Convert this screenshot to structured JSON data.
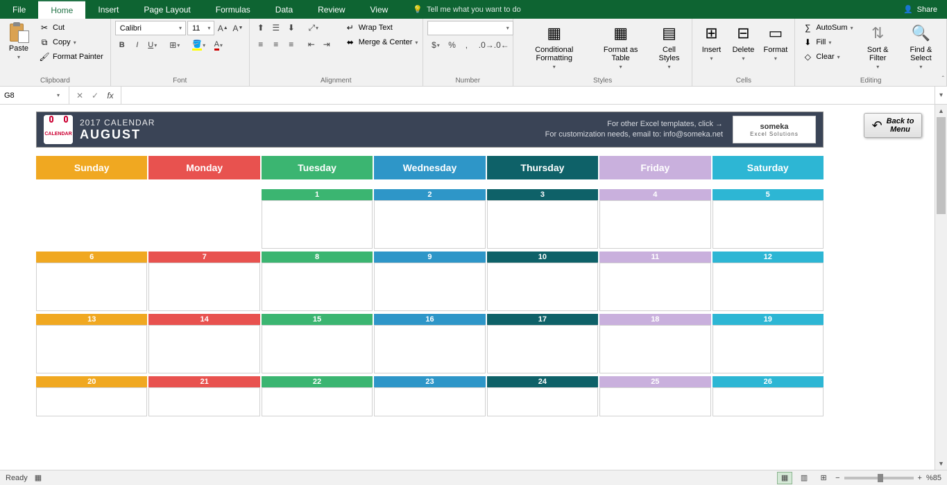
{
  "tabs": [
    "File",
    "Home",
    "Insert",
    "Page Layout",
    "Formulas",
    "Data",
    "Review",
    "View"
  ],
  "activeTab": "Home",
  "tellMe": "Tell me what you want to do",
  "share": "Share",
  "ribbon": {
    "clipboard": {
      "label": "Clipboard",
      "paste": "Paste",
      "cut": "Cut",
      "copy": "Copy",
      "formatPainter": "Format Painter"
    },
    "font": {
      "label": "Font",
      "name": "Calibri",
      "size": "11"
    },
    "alignment": {
      "label": "Alignment",
      "wrap": "Wrap Text",
      "merge": "Merge & Center"
    },
    "number": {
      "label": "Number",
      "format": ""
    },
    "styles": {
      "label": "Styles",
      "cond": "Conditional Formatting",
      "tbl": "Format as Table",
      "cell": "Cell Styles"
    },
    "cells": {
      "label": "Cells",
      "insert": "Insert",
      "delete": "Delete",
      "format": "Format"
    },
    "editing": {
      "label": "Editing",
      "autosum": "AutoSum",
      "fill": "Fill",
      "clear": "Clear",
      "sort": "Sort & Filter",
      "find": "Find & Select"
    }
  },
  "nameBox": "G8",
  "formulaValue": "",
  "calendar": {
    "year": "2017 CALENDAR",
    "month": "AUGUST",
    "info1": "For other Excel templates, click →",
    "info2": "For customization needs, email to: info@someka.net",
    "brand": "someka",
    "brandSub": "Excel Solutions",
    "back1": "Back to",
    "back2": "Menu",
    "weekdays": [
      "Sunday",
      "Monday",
      "Tuesday",
      "Wednesday",
      "Thursday",
      "Friday",
      "Saturday"
    ],
    "weeks": [
      [
        "",
        "",
        "1",
        "2",
        "3",
        "4",
        "5"
      ],
      [
        "6",
        "7",
        "8",
        "9",
        "10",
        "11",
        "12"
      ],
      [
        "13",
        "14",
        "15",
        "16",
        "17",
        "18",
        "19"
      ],
      [
        "20",
        "21",
        "22",
        "23",
        "24",
        "25",
        "26"
      ]
    ]
  },
  "dayColors": [
    "c-sun",
    "c-mon",
    "c-tue",
    "c-wed",
    "c-thu",
    "c-fri",
    "c-sat"
  ],
  "status": {
    "ready": "Ready",
    "zoom": "%85"
  }
}
